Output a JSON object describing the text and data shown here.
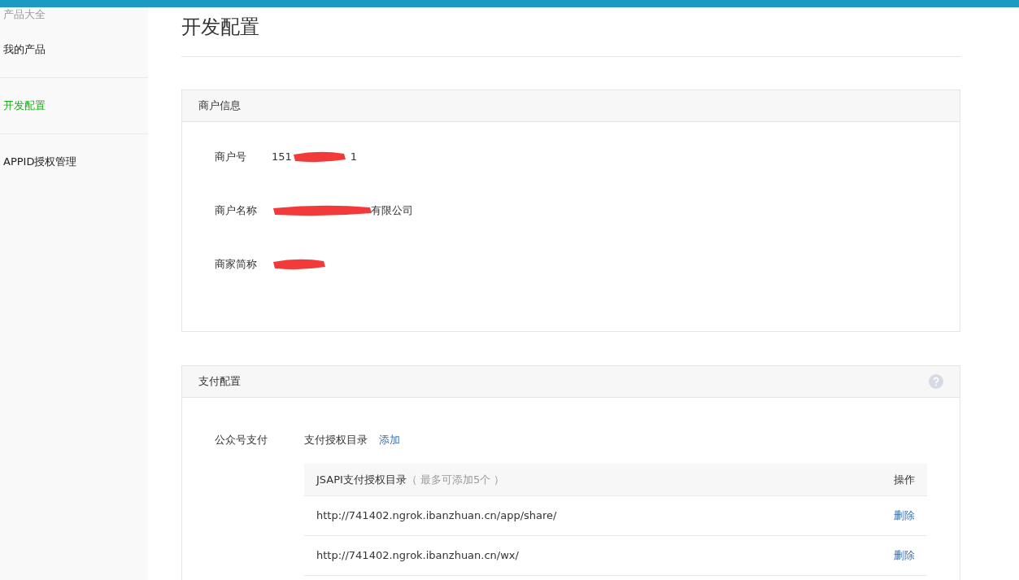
{
  "sidebar": {
    "section_title": "产品大全",
    "items": [
      {
        "label": "我的产品",
        "selected": false
      },
      {
        "label": "开发配置",
        "selected": true
      },
      {
        "label": "APPID授权管理",
        "selected": false
      }
    ]
  },
  "page_title": "开发配置",
  "merchant_panel": {
    "title": "商户信息",
    "fields": [
      {
        "label": "商户号",
        "before": "151",
        "after": "1",
        "redacted": true
      },
      {
        "label": "商户名称",
        "after": "有限公司",
        "redacted": true
      },
      {
        "label": "商家简称",
        "redacted": true
      }
    ]
  },
  "payment_panel": {
    "title": "支付配置",
    "row_label": "公众号支付",
    "dir_label": "支付授权目录",
    "add_link": "添加",
    "table": {
      "columns": [
        {
          "title": "JSAPI支付授权目录",
          "note": "（ 最多可添加5个 ）"
        },
        {
          "title": "操作"
        }
      ],
      "rows": [
        {
          "url": "http://741402.ngrok.ibanzhuan.cn/app/share/",
          "action": "删除"
        },
        {
          "url": "http://741402.ngrok.ibanzhuan.cn/wx/",
          "action": "删除"
        }
      ]
    }
  }
}
